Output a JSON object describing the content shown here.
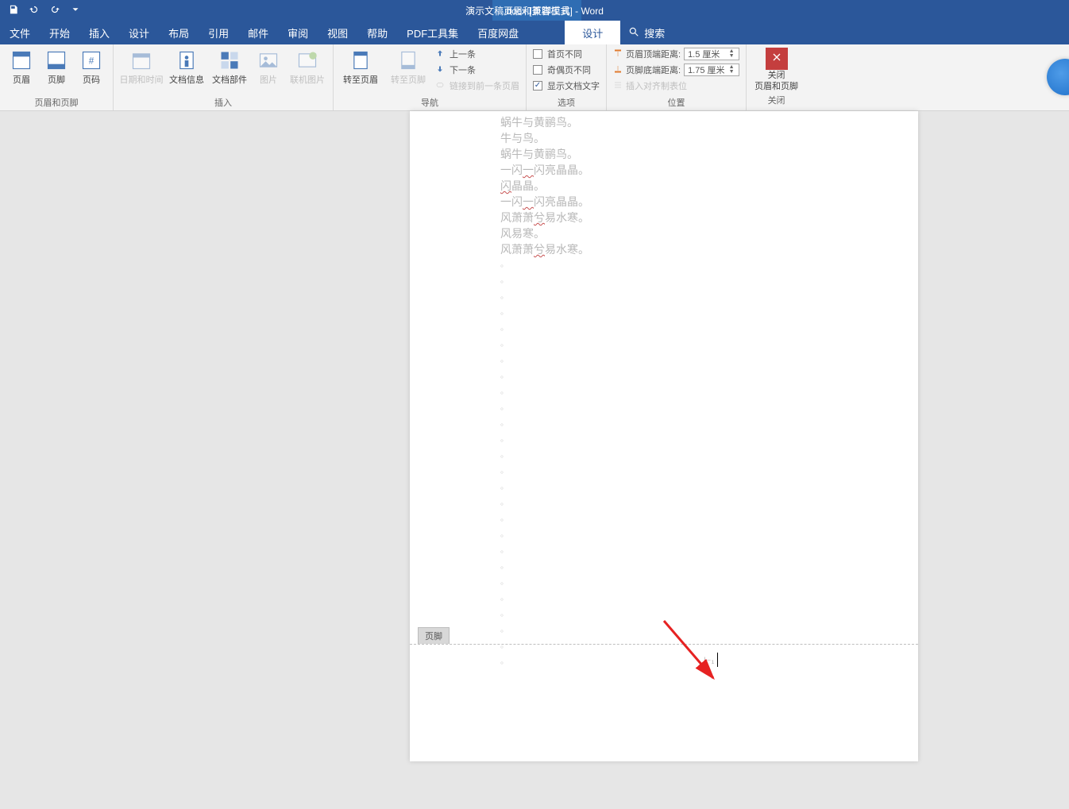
{
  "titlebar": {
    "contextual_tab": "页眉和页脚工具",
    "doc_title": "演示文稿.docx [兼容模式] - Word"
  },
  "tabs": {
    "file": "文件",
    "home": "开始",
    "insert": "插入",
    "design": "设计",
    "layout": "布局",
    "references": "引用",
    "mailings": "邮件",
    "review": "审阅",
    "view": "视图",
    "help": "帮助",
    "pdf": "PDF工具集",
    "baidu": "百度网盘",
    "hf_design": "设计",
    "search": "搜索"
  },
  "ribbon": {
    "group_hf": {
      "label": "页眉和页脚",
      "header": "页眉",
      "footer": "页脚",
      "pagenum": "页码"
    },
    "group_insert": {
      "label": "插入",
      "datetime": "日期和时间",
      "docinfo": "文档信息",
      "docparts": "文档部件",
      "pictures": "图片",
      "online_pictures": "联机图片"
    },
    "group_nav": {
      "label": "导航",
      "goto_header": "转至页眉",
      "goto_footer": "转至页脚",
      "prev": "上一条",
      "next": "下一条",
      "link_prev": "链接到前一条页眉"
    },
    "group_options": {
      "label": "选项",
      "first_diff": "首页不同",
      "odd_even_diff": "奇偶页不同",
      "show_doc_text": "显示文档文字"
    },
    "group_position": {
      "label": "位置",
      "header_dist_label": "页眉顶端距离:",
      "header_dist_value": "1.5 厘米",
      "footer_dist_label": "页脚底端距离:",
      "footer_dist_value": "1.75 厘米",
      "insert_align_tab": "插入对齐制表位"
    },
    "group_close": {
      "label": "关闭",
      "line1": "关闭",
      "line2": "页眉和页脚"
    }
  },
  "document": {
    "footer_label": "页脚",
    "body_lines": [
      {
        "plain": "蜗牛与黄鹂鸟。"
      },
      {
        "plain": "牛与鸟。"
      },
      {
        "plain": "蜗牛与黄鹂鸟。"
      },
      {
        "pre": "一闪",
        "wavy": "一",
        "post": "闪亮晶晶。"
      },
      {
        "wavy": "闪",
        "post": "晶晶。"
      },
      {
        "pre": "一闪",
        "wavy": "一",
        "post": "闪亮晶晶。"
      },
      {
        "pre": "风萧萧",
        "wavy": "兮",
        "post": "易水寒。"
      },
      {
        "plain": "风易寒。"
      },
      {
        "pre": "风萧萧",
        "wavy": "兮",
        "post": "易水寒。"
      }
    ]
  }
}
